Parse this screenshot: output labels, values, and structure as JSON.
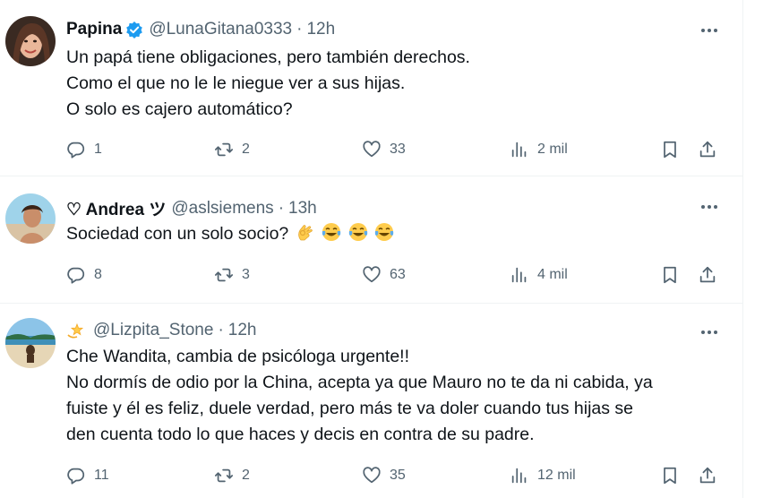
{
  "tweets": [
    {
      "name": "Papina",
      "handle": "@LunaGitana0333",
      "separator": "·",
      "time": "12h",
      "verified": true,
      "lines": [
        "Un papá tiene obligaciones, pero también derechos.",
        "Como el que no le le niegue ver a sus hijas.",
        "O solo es cajero automático?"
      ],
      "replies": "1",
      "retweets": "2",
      "likes": "33",
      "views": "2 mil"
    },
    {
      "name": "♡ Andrea ツ",
      "handle": "@aslsiemens",
      "separator": "·",
      "time": "13h",
      "lines": [
        "Sociedad con un solo socio?"
      ],
      "emojis": [
        "ok-hand-emoji",
        "tears-of-joy-emoji",
        "tears-of-joy-emoji",
        "tears-of-joy-emoji"
      ],
      "replies": "8",
      "retweets": "3",
      "likes": "63",
      "views": "4 mil"
    },
    {
      "name": "",
      "handle": "@Lizpita_Stone",
      "separator": "·",
      "time": "12h",
      "name_icon": "dizzy-star-emoji",
      "lines": [
        "Che Wandita, cambia de psicóloga urgente!!",
        "No dormís de odio por la China, acepta ya que Mauro no te da ni cabida, ya",
        "fuiste y él es feliz, duele verdad, pero más te va doler cuando tus hijas se",
        "den cuenta todo lo que haces y decis en contra de su padre."
      ],
      "replies": "11",
      "retweets": "2",
      "likes": "35",
      "views": "12 mil"
    }
  ],
  "colors": {
    "text": "#0f1419",
    "muted": "#536471",
    "verified": "#1d9bf0",
    "divider": "#eff3f4"
  }
}
